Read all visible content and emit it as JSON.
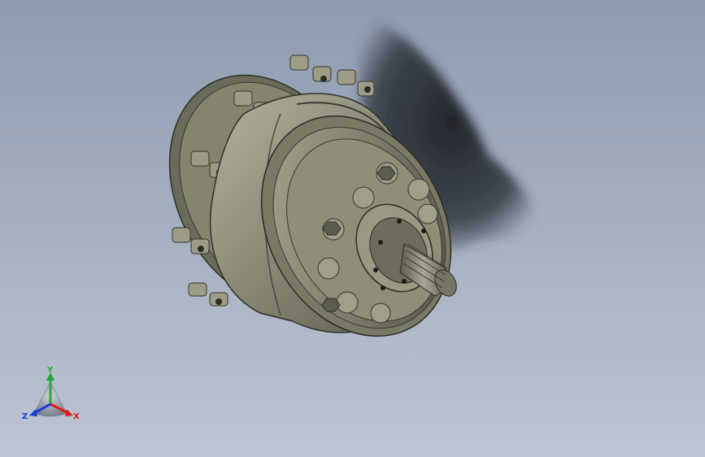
{
  "viewport": {
    "background_top": "#8e9bb0",
    "background_bottom": "#bdc5d2"
  },
  "model": {
    "body_color": "#8b8b78",
    "dark_color": "#3d3d33",
    "shadow_color": "#1f2228",
    "icon": "gear-motor-model"
  },
  "triad": {
    "y_label": "Y",
    "x_label": "X",
    "z_label": "Z",
    "y_color": "#1fae2f",
    "x_color": "#e01a1a",
    "z_color": "#1a3cd8"
  }
}
